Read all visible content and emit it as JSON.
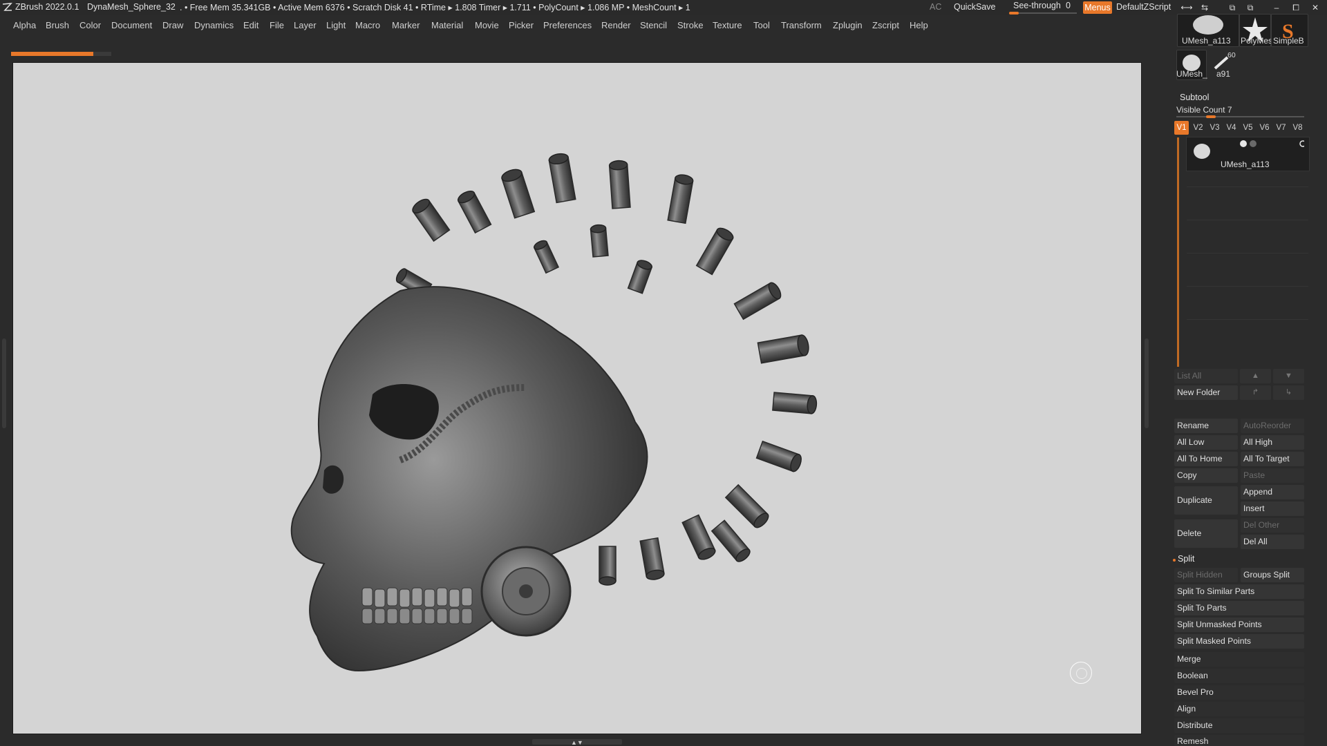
{
  "titlebar": {
    "app": "ZBrush 2022.0.1",
    "document": "DynaMesh_Sphere_32",
    "stats": ". • Free Mem 35.341GB • Active Mem 6376 • Scratch Disk 41 • RTime ▸ 1.808 Timer ▸ 1.711 • PolyCount ▸ 1.086 MP • MeshCount ▸ 1",
    "ac": "AC",
    "quicksave": "QuickSave",
    "seethrough_label": "See-through",
    "seethrough_value": "0",
    "menus": "Menus",
    "script": "DefaultZScript",
    "win_icons": [
      "⟷",
      "⇆",
      "⧉",
      "–",
      "⧠",
      "✕"
    ]
  },
  "menubar": {
    "items": [
      "Alpha",
      "Brush",
      "Color",
      "Document",
      "Draw",
      "Dynamics",
      "Edit",
      "File",
      "Layer",
      "Light",
      "Macro",
      "Marker",
      "Material",
      "Movie",
      "Picker",
      "Preferences",
      "Render",
      "Stencil",
      "Stroke",
      "Texture",
      "Tool",
      "Transform",
      "Zplugin",
      "Zscript",
      "Help"
    ]
  },
  "progress": {
    "fraction": 0.82
  },
  "tool_thumbs": {
    "items": [
      {
        "label": "UMesh_a113"
      },
      {
        "label": "PolyMes"
      },
      {
        "label": "SimpleB"
      },
      {
        "label": "UMesh_"
      },
      {
        "label": "a91",
        "badge": "60"
      }
    ]
  },
  "subtool": {
    "header": "Subtool",
    "visible_count": "Visible Count 7",
    "visible_fraction": 0.25,
    "tabs": [
      "V1",
      "V2",
      "V3",
      "V4",
      "V5",
      "V6",
      "V7",
      "V8"
    ],
    "active_tab": "V1",
    "item_name": "UMesh_a113",
    "buttons": {
      "list_all": "List All",
      "new_folder": "New Folder",
      "rename": "Rename",
      "autoreorder": "AutoReorder",
      "all_low": "All Low",
      "all_high": "All High",
      "all_to_home": "All To Home",
      "all_to_target": "All To Target",
      "copy": "Copy",
      "paste": "Paste",
      "duplicate": "Duplicate",
      "append": "Append",
      "insert": "Insert",
      "delete": "Delete",
      "del_other": "Del Other",
      "del_all": "Del All"
    }
  },
  "split": {
    "header": "Split",
    "buttons": {
      "split_hidden": "Split Hidden",
      "groups_split": "Groups Split",
      "split_similar": "Split To Similar Parts",
      "split_parts": "Split To Parts",
      "split_unmasked": "Split Unmasked Points",
      "split_masked": "Split Masked Points"
    }
  },
  "panels": [
    "Merge",
    "Boolean",
    "Bevel Pro",
    "Align",
    "Distribute",
    "Remesh"
  ]
}
